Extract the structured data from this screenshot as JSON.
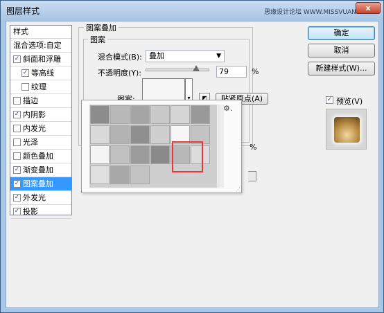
{
  "window": {
    "title": "图层样式",
    "watermark": "思缘设计论坛 WWW.MISSVUAN.COM",
    "close_glyph": "x"
  },
  "left_list": {
    "items": [
      {
        "label": "样式",
        "type": "header"
      },
      {
        "label": "混合选项:自定",
        "type": "header"
      },
      {
        "label": "斜面和浮雕",
        "checked": true
      },
      {
        "label": "等高线",
        "checked": true,
        "sub": true
      },
      {
        "label": "纹理",
        "checked": false,
        "sub": true
      },
      {
        "label": "描边",
        "checked": false
      },
      {
        "label": "内阴影",
        "checked": true
      },
      {
        "label": "内发光",
        "checked": false
      },
      {
        "label": "光泽",
        "checked": false
      },
      {
        "label": "颜色叠加",
        "checked": false
      },
      {
        "label": "渐变叠加",
        "checked": true
      },
      {
        "label": "图案叠加",
        "checked": true,
        "selected": true
      },
      {
        "label": "外发光",
        "checked": true
      },
      {
        "label": "投影",
        "checked": true
      }
    ],
    "check_glyph": "✓"
  },
  "panel": {
    "group_title": "图案叠加",
    "subgroup_title": "图案",
    "blend_mode_label": "混合模式(B):",
    "blend_mode_value": "叠加",
    "opacity_label": "不透明度(Y):",
    "opacity_value": "79",
    "opacity_unit": "%",
    "pattern_label": "图案:",
    "snap_origin_button": "贴紧原点(A)",
    "hidden_unit": "%"
  },
  "pattern_picker": {
    "gear_glyph": "⚙.",
    "grip_glyph": "⋰",
    "tiles": [
      "#8c8c8c",
      "#b9b9b9",
      "#a5a5a5",
      "#c9c9c9",
      "#d6d6d6",
      "#999999",
      "#dadada",
      "#b3b3b3",
      "#8f8f8f",
      "#cfcfcf",
      "#f7f7f7",
      "#c4c4c4",
      "#f4f4f4",
      "#c0c0c0",
      "#9b9b9b",
      "#8a8a8a",
      "#b8b8b8",
      "#dcdcdc",
      "#e0e0e0",
      "#a8a8a8",
      "#c3c3c3"
    ]
  },
  "buttons": {
    "ok": "确定",
    "cancel": "取消",
    "new_style": "新建样式(W)...",
    "preview_label": "预览(V)"
  },
  "colors": {
    "highlight": "#e53935",
    "selection": "#3399ff"
  }
}
